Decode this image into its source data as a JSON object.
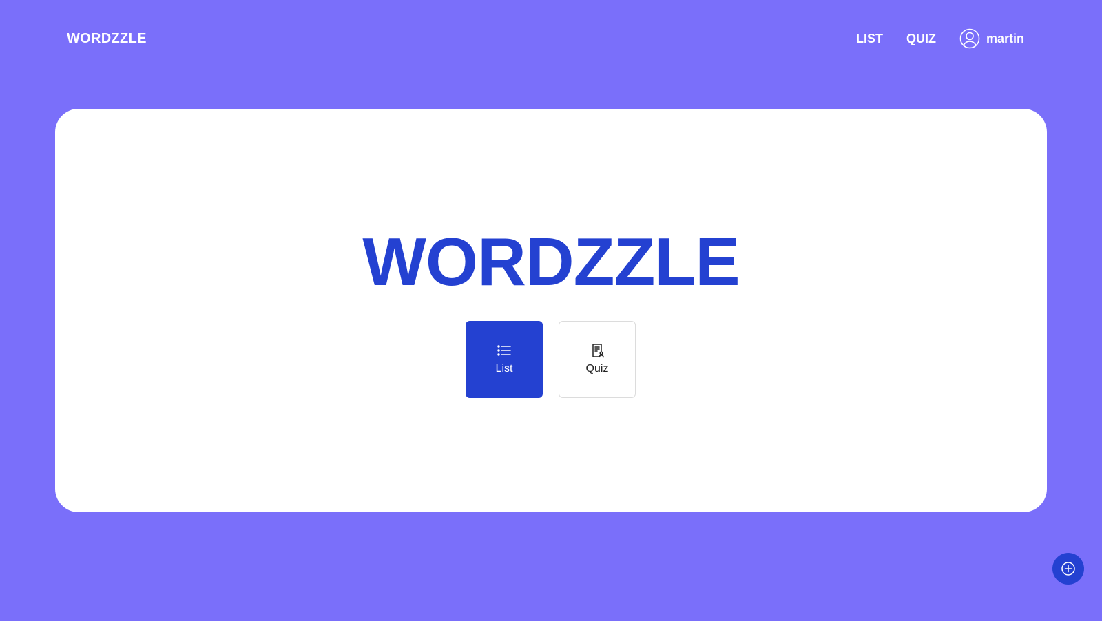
{
  "header": {
    "brand": "WORDZZLE",
    "nav": [
      {
        "label": "LIST"
      },
      {
        "label": "QUIZ"
      }
    ],
    "user": {
      "icon": "user-circle-icon",
      "name": "martin"
    }
  },
  "hero": {
    "title": "WORDZZLE",
    "tiles": [
      {
        "label": "List",
        "icon": "list-icon"
      },
      {
        "label": "Quiz",
        "icon": "quiz-document-icon"
      }
    ]
  },
  "fab": {
    "icon": "plus-circle-icon"
  },
  "colors": {
    "background": "#7a6ffa",
    "accent": "#2441d1",
    "card": "#ffffff"
  }
}
